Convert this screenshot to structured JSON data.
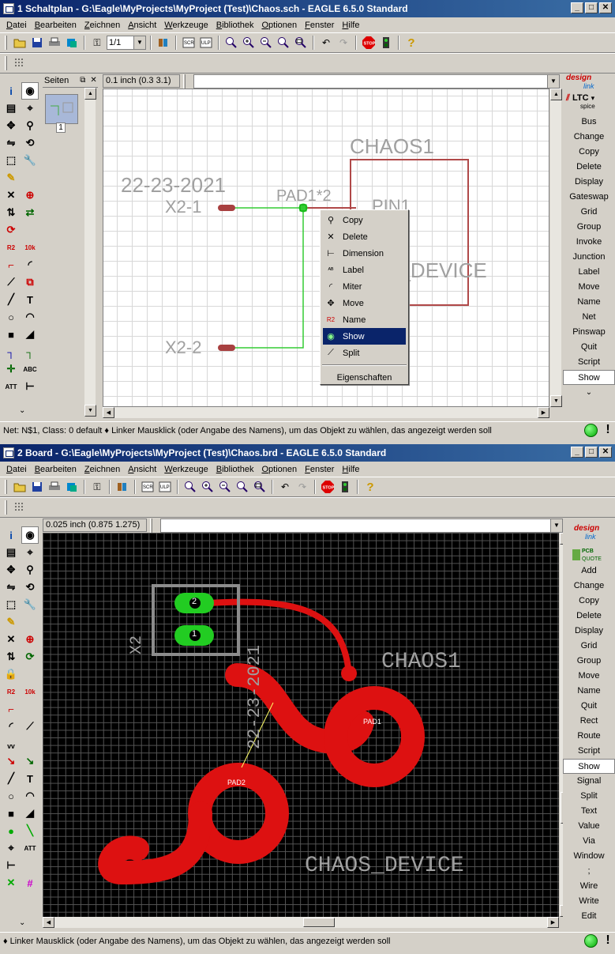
{
  "sch": {
    "title": "1 Schaltplan - G:\\Eagle\\MyProjects\\MyProject (Test)\\Chaos.sch - EAGLE 6.5.0 Standard",
    "menu": [
      "Datei",
      "Bearbeiten",
      "Zeichnen",
      "Ansicht",
      "Werkzeuge",
      "Bibliothek",
      "Optionen",
      "Fenster",
      "Hilfe"
    ],
    "sheet_select": "1/1",
    "pages_label": "Seiten",
    "page_number": "1",
    "coord": "0.1 inch (0.3 3.1)",
    "right_commands": [
      "Bus",
      "Change",
      "Copy",
      "Delete",
      "Display",
      "Gateswap",
      "Grid",
      "Group",
      "Invoke",
      "Junction",
      "Label",
      "Move",
      "Name",
      "Net",
      "Pinswap",
      "Quit",
      "Script",
      "Show"
    ],
    "selected_command": "Show",
    "canvas": {
      "part_name": "CHAOS1",
      "pin": "PIN1",
      "device": "CHAOS_DEVICE",
      "connector_value": "22-23-2021",
      "pad_label": "PAD1*2",
      "x2_1": "X2-1",
      "x2_2": "X2-2"
    },
    "context_menu": [
      {
        "icon": "copy-icon",
        "glyph": "⚲",
        "label": "Copy"
      },
      {
        "icon": "delete-icon",
        "glyph": "✕",
        "label": "Delete"
      },
      {
        "icon": "dimension-icon",
        "glyph": "⊢",
        "label": "Dimension"
      },
      {
        "icon": "label-icon",
        "glyph": "ᴬᴮ",
        "label": "Label"
      },
      {
        "icon": "miter-icon",
        "glyph": "◜",
        "label": "Miter"
      },
      {
        "icon": "move-icon",
        "glyph": "✥",
        "label": "Move"
      },
      {
        "icon": "name-icon",
        "glyph": "R2",
        "label": "Name"
      },
      {
        "icon": "show-icon",
        "glyph": "◉",
        "label": "Show"
      },
      {
        "icon": "split-icon",
        "glyph": "⟋",
        "label": "Split"
      }
    ],
    "context_selected": "Show",
    "context_properties": "Eigenschaften",
    "status": "Net: N$1, Class: 0 default  ♦ Linker Mausklick (oder Angabe des Namens), um das Objekt zu wählen, das angezeigt werden soll",
    "logos": {
      "design_link": "design",
      "design_link2": "link",
      "ltc": "LTC",
      "ltc2": "spice"
    }
  },
  "brd": {
    "title": "2 Board - G:\\Eagle\\MyProjects\\MyProject (Test)\\Chaos.brd - EAGLE 6.5.0 Standard",
    "menu": [
      "Datei",
      "Bearbeiten",
      "Zeichnen",
      "Ansicht",
      "Werkzeuge",
      "Bibliothek",
      "Optionen",
      "Fenster",
      "Hilfe"
    ],
    "coord": "0.025 inch (0.875 1.275)",
    "right_commands": [
      "Add",
      "Change",
      "Copy",
      "Delete",
      "Display",
      "Grid",
      "Group",
      "Move",
      "Name",
      "Quit",
      "Rect",
      "Route",
      "Script",
      "Show",
      "Signal",
      "Split",
      "Text",
      "Value",
      "Via",
      "Window",
      ";",
      "Wire",
      "Write",
      "Edit"
    ],
    "selected_command": "Show",
    "canvas": {
      "connector_value": "22-23-2021",
      "x2": "X2",
      "part_name": "CHAOS1",
      "device": "CHAOS_DEVICE",
      "pad1": "PAD1",
      "pad2": "PAD2",
      "pin1": "1",
      "pin2": "2"
    },
    "status": "♦ Linker Mausklick (oder Angabe des Namens), um das Objekt zu wählen, das angezeigt werden soll",
    "logos": {
      "design_link": "design",
      "design_link2": "link",
      "pcb": "PCB",
      "pcb2": "QUOTE"
    }
  },
  "colors": {
    "title_start": "#0a246a",
    "title_end": "#3a6ea5",
    "net_green": "#33cc33",
    "part_red": "#b04848",
    "copper_red": "#dd1111",
    "pad_green": "#22cc22",
    "board_bg": "#000000",
    "text_gray": "#a0a0a0"
  }
}
